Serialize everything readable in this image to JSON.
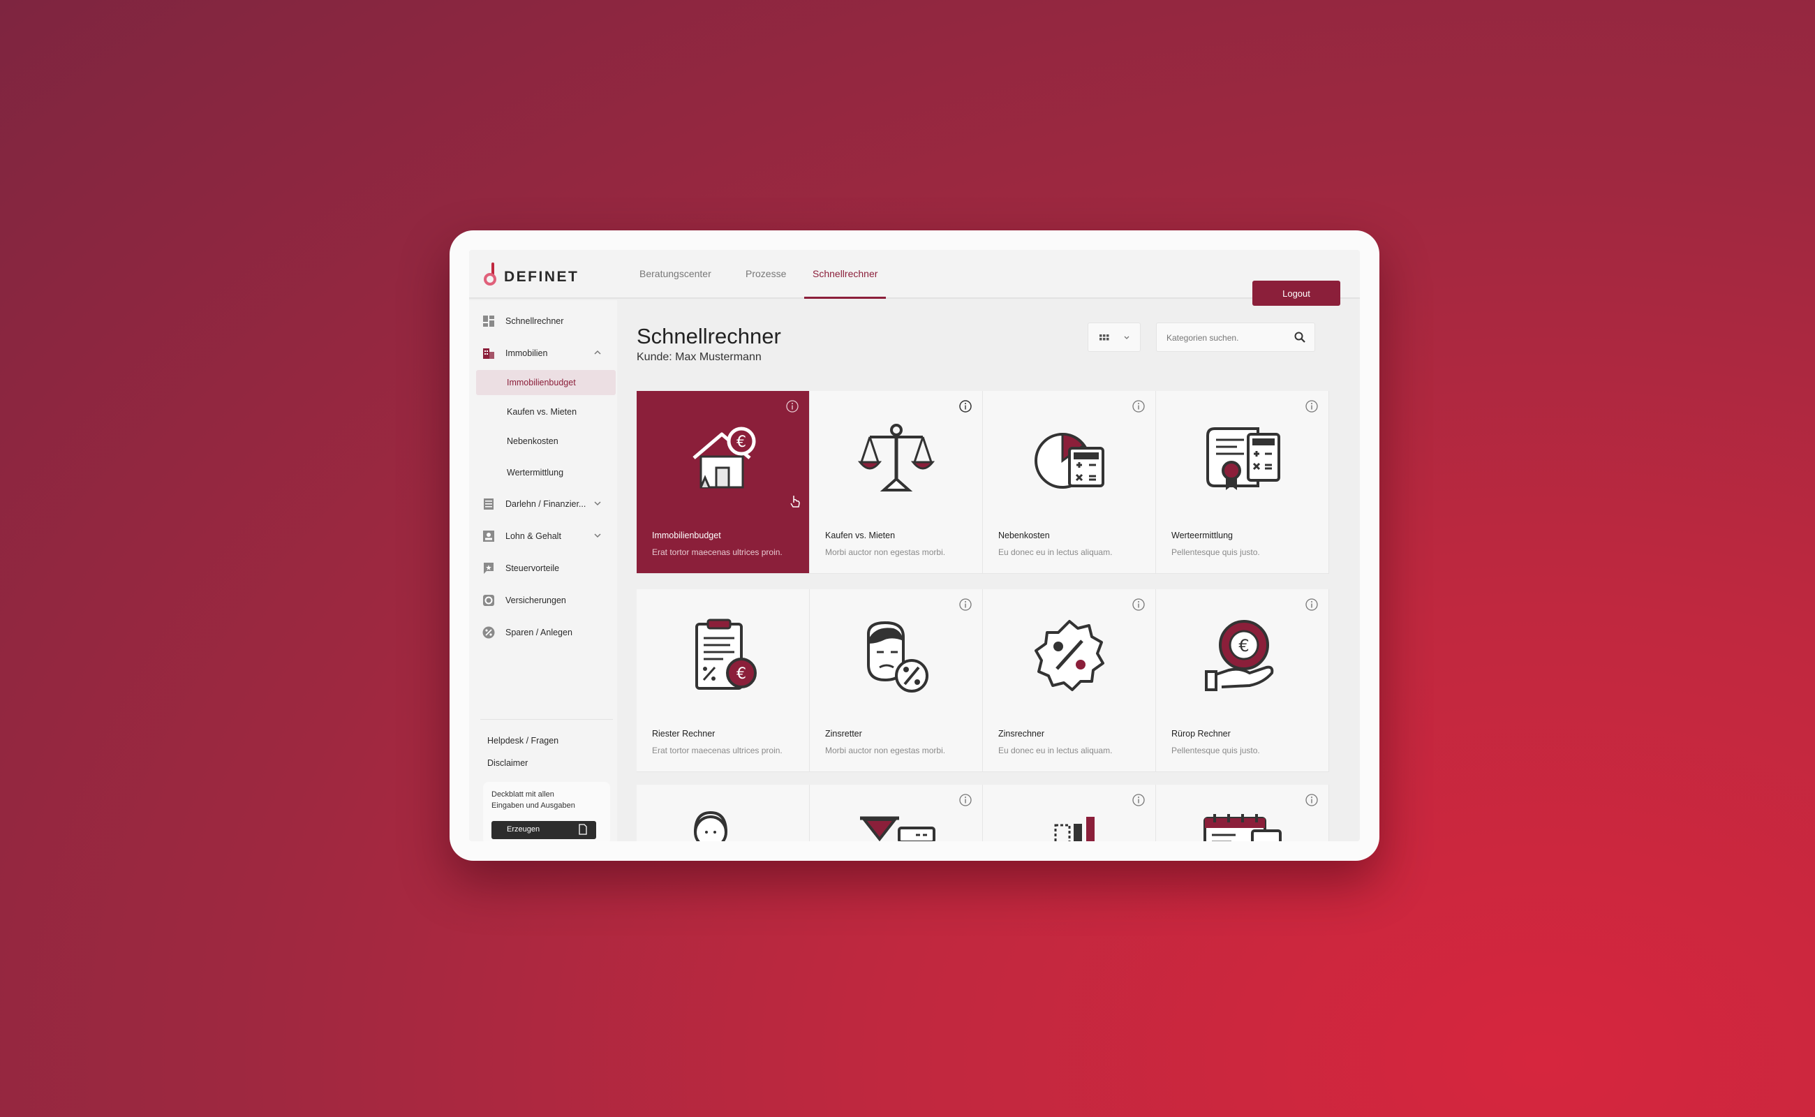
{
  "brand": {
    "name": "DEFINET",
    "accent": "#8b1f3a"
  },
  "nav": {
    "tabs": [
      {
        "label": "Beratungscenter",
        "active": false
      },
      {
        "label": "Prozesse",
        "active": false
      },
      {
        "label": "Schnellrechner",
        "active": true
      }
    ],
    "logout_label": "Logout"
  },
  "sidebar": {
    "items": [
      {
        "label": "Schnellrechner",
        "icon": "dashboard-icon"
      },
      {
        "label": "Immobilien",
        "icon": "building-icon",
        "expanded": true
      },
      {
        "label": "Darlehn / Finanzier...",
        "icon": "document-icon",
        "expanded": false
      },
      {
        "label": "Lohn & Gehalt",
        "icon": "id-card-icon",
        "expanded": false
      },
      {
        "label": "Steuervorteile",
        "icon": "flag-icon"
      },
      {
        "label": "Versicherungen",
        "icon": "shield-icon"
      },
      {
        "label": "Sparen / Anlegen",
        "icon": "percent-icon"
      }
    ],
    "subitems": [
      {
        "label": "Immobilienbudget",
        "active": true
      },
      {
        "label": "Kaufen vs. Mieten",
        "active": false
      },
      {
        "label": "Nebenkosten",
        "active": false
      },
      {
        "label": "Wertermittlung",
        "active": false
      }
    ],
    "footer_links": [
      "Helpdesk / Fragen",
      "Disclaimer"
    ],
    "deckblatt": {
      "text": "Deckblatt mit allen Eingaben und Ausgaben",
      "button_label": "Erzeugen"
    }
  },
  "main": {
    "title": "Schnellrechner",
    "subtitle": "Kunde: Max Mustermann",
    "search_placeholder": "Kategorien suchen.",
    "cards": [
      {
        "title": "Immobilienbudget",
        "desc": "Erat tortor maecenas ultrices proin.",
        "icon": "house-euro-icon",
        "active": true
      },
      {
        "title": "Kaufen vs. Mieten",
        "desc": "Morbi auctor non egestas morbi.",
        "icon": "scale-icon",
        "active": false
      },
      {
        "title": "Nebenkosten",
        "desc": "Eu donec eu in lectus aliquam.",
        "icon": "pie-calculator-icon",
        "active": false
      },
      {
        "title": "Werteermittlung",
        "desc": "Pellentesque quis justo.",
        "icon": "certificate-calculator-icon",
        "active": false
      },
      {
        "title": "Riester Rechner",
        "desc": "Erat tortor maecenas ultrices proin.",
        "icon": "clipboard-euro-icon",
        "active": false
      },
      {
        "title": "Zinsretter",
        "desc": "Morbi auctor non egestas morbi.",
        "icon": "person-percent-icon",
        "active": false
      },
      {
        "title": "Zinsrechner",
        "desc": "Eu donec eu in lectus aliquam.",
        "icon": "percent-badge-icon",
        "active": false
      },
      {
        "title": "Rürop Rechner",
        "desc": "Pellentesque quis justo.",
        "icon": "hand-euro-icon",
        "active": false
      },
      {
        "title": "",
        "desc": "",
        "icon": "person-headset-icon",
        "active": false
      },
      {
        "title": "",
        "desc": "",
        "icon": "hourglass-icon",
        "active": false
      },
      {
        "title": "",
        "desc": "",
        "icon": "bar-chart-icon",
        "active": false
      },
      {
        "title": "",
        "desc": "",
        "icon": "calendar-icon",
        "active": false
      }
    ]
  }
}
